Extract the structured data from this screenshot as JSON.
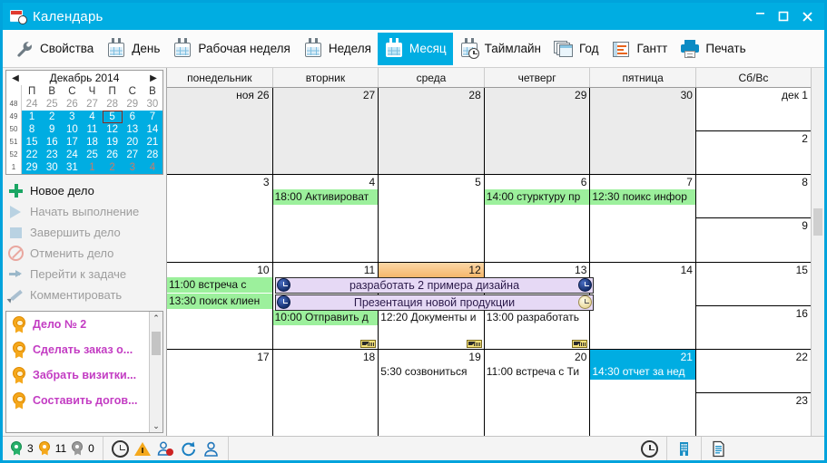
{
  "window": {
    "title": "Календарь",
    "icon": "calendar-clock-icon",
    "minimize": "–",
    "maximize": "□",
    "close": "✕",
    "accent_color": "#00ADE2"
  },
  "toolbar": {
    "items": [
      {
        "label": "Свойства",
        "icon": "wrench-icon",
        "active": false
      },
      {
        "label": "День",
        "icon": "calendar-day-icon",
        "active": false
      },
      {
        "label": "Рабочая неделя",
        "icon": "calendar-workweek-icon",
        "active": false
      },
      {
        "label": "Неделя",
        "icon": "calendar-week-icon",
        "active": false
      },
      {
        "label": "Месяц",
        "icon": "calendar-month-icon",
        "active": true
      },
      {
        "label": "Таймлайн",
        "icon": "calendar-timeline-icon",
        "active": false
      },
      {
        "label": "Год",
        "icon": "calendar-year-icon",
        "active": false
      },
      {
        "label": "Гантт",
        "icon": "gantt-chart-icon",
        "active": false
      },
      {
        "label": "Печать",
        "icon": "printer-icon",
        "active": false
      }
    ]
  },
  "sidebar": {
    "minicalendar": {
      "prev": "◀",
      "next": "▶",
      "title": "Декабрь 2014",
      "dow": [
        "П",
        "В",
        "С",
        "Ч",
        "П",
        "С",
        "В"
      ],
      "weeks": [
        {
          "wk": "48",
          "days": [
            {
              "d": "24",
              "other": true
            },
            {
              "d": "25",
              "other": true
            },
            {
              "d": "26",
              "other": true
            },
            {
              "d": "27",
              "other": true
            },
            {
              "d": "28",
              "other": true
            },
            {
              "d": "29",
              "other": true
            },
            {
              "d": "30",
              "other": true
            }
          ]
        },
        {
          "wk": "49",
          "days": [
            {
              "d": "1",
              "sel": true
            },
            {
              "d": "2",
              "sel": true
            },
            {
              "d": "3",
              "sel": true
            },
            {
              "d": "4",
              "sel": true
            },
            {
              "d": "5",
              "sel": true,
              "today": true
            },
            {
              "d": "6",
              "sel": true
            },
            {
              "d": "7",
              "sel": true
            }
          ]
        },
        {
          "wk": "50",
          "days": [
            {
              "d": "8",
              "sel": true
            },
            {
              "d": "9",
              "sel": true
            },
            {
              "d": "10",
              "sel": true
            },
            {
              "d": "11",
              "sel": true
            },
            {
              "d": "12",
              "sel": true
            },
            {
              "d": "13",
              "sel": true
            },
            {
              "d": "14",
              "sel": true
            }
          ]
        },
        {
          "wk": "51",
          "days": [
            {
              "d": "15",
              "sel": true
            },
            {
              "d": "16",
              "sel": true
            },
            {
              "d": "17",
              "sel": true
            },
            {
              "d": "18",
              "sel": true
            },
            {
              "d": "19",
              "sel": true
            },
            {
              "d": "20",
              "sel": true
            },
            {
              "d": "21",
              "sel": true
            }
          ]
        },
        {
          "wk": "52",
          "days": [
            {
              "d": "22",
              "sel": true
            },
            {
              "d": "23",
              "sel": true
            },
            {
              "d": "24",
              "sel": true
            },
            {
              "d": "25",
              "sel": true
            },
            {
              "d": "26",
              "sel": true
            },
            {
              "d": "27",
              "sel": true
            },
            {
              "d": "28",
              "sel": true
            }
          ]
        },
        {
          "wk": "1",
          "days": [
            {
              "d": "29",
              "sel": true
            },
            {
              "d": "30",
              "sel": true
            },
            {
              "d": "31",
              "sel": true
            },
            {
              "d": "1",
              "sel": true,
              "other": true
            },
            {
              "d": "2",
              "sel": true,
              "other": true
            },
            {
              "d": "3",
              "sel": true,
              "other": true
            },
            {
              "d": "4",
              "sel": true,
              "other": true
            }
          ]
        }
      ]
    },
    "actions": [
      {
        "label": "Новое дело",
        "icon": "plus-icon",
        "enabled": true
      },
      {
        "label": "Начать выполнение",
        "icon": "play-icon",
        "enabled": false
      },
      {
        "label": "Завершить дело",
        "icon": "stop-icon",
        "enabled": false
      },
      {
        "label": "Отменить дело",
        "icon": "cancel-icon",
        "enabled": false
      },
      {
        "label": "Перейти к задаче",
        "icon": "arrow-right-icon",
        "enabled": false
      },
      {
        "label": "Комментировать",
        "icon": "pencil-icon",
        "enabled": false
      }
    ],
    "tasks": [
      {
        "label": "Дело № 2",
        "icon": "medal-icon"
      },
      {
        "label": "Сделать заказ о...",
        "icon": "medal-icon"
      },
      {
        "label": "Забрать визитки...",
        "icon": "medal-icon"
      },
      {
        "label": "Составить догов...",
        "icon": "medal-icon"
      }
    ],
    "scrollbar": {
      "up": "⌃",
      "down": "⌄"
    }
  },
  "calendar": {
    "dow_headers": [
      "понедельник",
      "вторник",
      "среда",
      "четверг",
      "пятница",
      "Сб/Вс"
    ],
    "weeks": [
      {
        "days": [
          {
            "num": "ноя 26",
            "grey": true,
            "events": []
          },
          {
            "num": "27",
            "grey": true,
            "events": []
          },
          {
            "num": "28",
            "grey": true,
            "events": []
          },
          {
            "num": "29",
            "grey": true,
            "events": []
          },
          {
            "num": "30",
            "grey": true,
            "events": []
          }
        ],
        "weekend": [
          {
            "num": "дек 1",
            "grey": false,
            "events": []
          },
          {
            "num": "2",
            "grey": false,
            "events": []
          }
        ],
        "spans": []
      },
      {
        "days": [
          {
            "num": "3",
            "grey": false,
            "events": []
          },
          {
            "num": "4",
            "grey": false,
            "events": [
              {
                "text": "18:00 Активироват",
                "style": "green"
              }
            ]
          },
          {
            "num": "5",
            "grey": false,
            "events": []
          },
          {
            "num": "6",
            "grey": false,
            "events": [
              {
                "text": "14:00 стурктуру пр",
                "style": "green"
              }
            ]
          },
          {
            "num": "7",
            "grey": false,
            "events": [
              {
                "text": "12:30 поикс инфор",
                "style": "green"
              }
            ]
          }
        ],
        "weekend": [
          {
            "num": "8",
            "grey": false,
            "events": []
          },
          {
            "num": "9",
            "grey": false,
            "events": []
          }
        ],
        "spans": []
      },
      {
        "days": [
          {
            "num": "10",
            "grey": false,
            "events": [
              {
                "text": "11:00 встреча с",
                "style": "green"
              },
              {
                "text": "13:30 поиск клиен",
                "style": "green"
              }
            ]
          },
          {
            "num": "11",
            "grey": false,
            "highlight": "orange_none",
            "events": [
              {
                "text": "",
                "style": "spacer"
              },
              {
                "text": "",
                "style": "spacer"
              },
              {
                "text": "10:00 Отправить д",
                "style": "green",
                "badge": true
              }
            ]
          },
          {
            "num": "12",
            "grey": false,
            "highlight": "orange",
            "events": [
              {
                "text": "",
                "style": "spacer"
              },
              {
                "text": "",
                "style": "spacer"
              },
              {
                "text": "12:20 Документы и",
                "style": "plain",
                "badge": true
              }
            ]
          },
          {
            "num": "13",
            "grey": false,
            "events": [
              {
                "text": "",
                "style": "spacer"
              },
              {
                "text": "",
                "style": "spacer"
              },
              {
                "text": "13:00 разработать",
                "style": "plain",
                "badge": true
              }
            ]
          },
          {
            "num": "14",
            "grey": false,
            "events": []
          }
        ],
        "weekend": [
          {
            "num": "15",
            "grey": false,
            "events": []
          },
          {
            "num": "16",
            "grey": false,
            "events": []
          }
        ],
        "spans": [
          {
            "text": "разработать 2 примера дизайна",
            "start": 1,
            "span": 3,
            "row": 0,
            "icon_left": "clock-navy-icon",
            "icon_right": "clock-navy-icon"
          },
          {
            "text": "Презентация новой продукции",
            "start": 1,
            "span": 3,
            "row": 1,
            "icon_left": "clock-navy-icon",
            "icon_right": "clock-cream-icon"
          }
        ]
      },
      {
        "days": [
          {
            "num": "17",
            "grey": false,
            "events": []
          },
          {
            "num": "18",
            "grey": false,
            "events": []
          },
          {
            "num": "19",
            "grey": false,
            "events": [
              {
                "text": "5:30 созвониться",
                "style": "plain"
              }
            ]
          },
          {
            "num": "20",
            "grey": false,
            "events": [
              {
                "text": "11:00 встреча с Ти",
                "style": "plain"
              }
            ]
          },
          {
            "num": "21",
            "grey": false,
            "highlight": "blue",
            "events": [
              {
                "text": "14:30 отчет за нед",
                "style": "blue"
              }
            ]
          }
        ],
        "weekend": [
          {
            "num": "22",
            "grey": false,
            "events": []
          },
          {
            "num": "23",
            "grey": false,
            "events": []
          }
        ],
        "spans": []
      }
    ]
  },
  "statusbar": {
    "counts": [
      {
        "value": "3",
        "icon": "medal-green-icon"
      },
      {
        "value": "11",
        "icon": "medal-orange-icon"
      },
      {
        "value": "0",
        "icon": "medal-grey-icon"
      }
    ],
    "tools": [
      "clock-icon",
      "warning-icon",
      "user-alert-icon",
      "refresh-icon",
      "user-icon"
    ],
    "panels": [
      "clock-icon",
      "building-icon",
      "document-icon"
    ]
  }
}
